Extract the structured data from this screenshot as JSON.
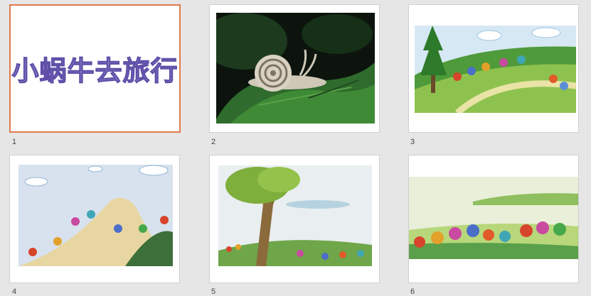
{
  "slides": [
    {
      "number": "1",
      "title": "小蜗牛去旅行",
      "selected": true
    },
    {
      "number": "2",
      "image": "snail-on-leaf-photo"
    },
    {
      "number": "3",
      "image": "snails-on-green-hill-painting"
    },
    {
      "number": "4",
      "image": "snails-climbing-hill-painting"
    },
    {
      "number": "5",
      "image": "tree-and-snails-painting"
    },
    {
      "number": "6",
      "image": "colorful-snails-row-painting"
    }
  ],
  "colors": {
    "selected_border": "#e07a4c",
    "title_fill": "#9f93d6",
    "title_stroke": "#5f4fa8"
  }
}
